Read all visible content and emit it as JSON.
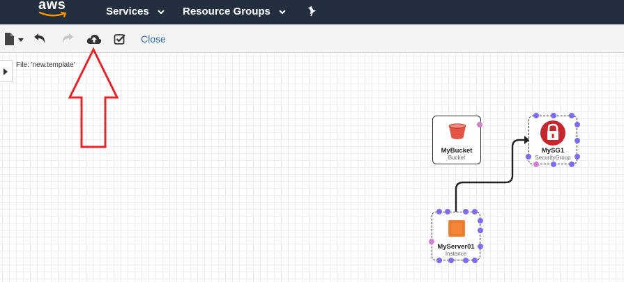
{
  "nav": {
    "logo": "aws",
    "services": "Services",
    "resource_groups": "Resource Groups"
  },
  "toolbar": {
    "close": "Close"
  },
  "canvas": {
    "file_label": "File: 'new.template'",
    "resources": [
      {
        "name": "MyBucket",
        "type": "Bucket"
      },
      {
        "name": "MySG1",
        "type": "SecurityGroup"
      },
      {
        "name": "MyServer01",
        "type": "Instance"
      }
    ]
  },
  "colors": {
    "nav_bg": "#232f3e",
    "toolbar_bg": "#f4f4f4",
    "link": "#2a6fb4",
    "annotation_arrow": "#e8232a",
    "bucket": "#e25444",
    "security_group": "#c7262e",
    "instance": "#f58536",
    "port_dot": "#7c6cf0",
    "port_dot_alt": "#d77fd2"
  },
  "icons": [
    "new-file-icon",
    "undo-icon",
    "redo-icon",
    "upload-cloud-icon",
    "validate-check-icon",
    "pin-icon",
    "lock-icon",
    "bucket-icon",
    "instance-icon"
  ]
}
